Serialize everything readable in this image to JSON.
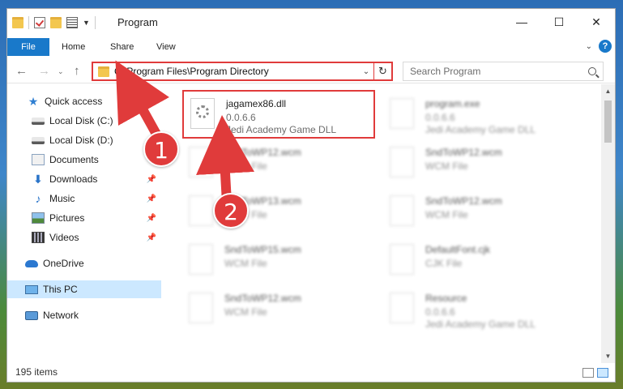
{
  "window": {
    "title": "Program",
    "controls": {
      "minimize": "—",
      "maximize": "☐",
      "close": "✕"
    }
  },
  "ribbon": {
    "tabs": [
      "File",
      "Home",
      "Share",
      "View"
    ],
    "help": "?"
  },
  "address": {
    "path": "C:\\Program Files\\Program Directory",
    "refresh_icon": "refresh-icon"
  },
  "search": {
    "placeholder": "Search Program"
  },
  "sidebar": {
    "items": [
      {
        "label": "Quick access",
        "icon": "star-icon"
      },
      {
        "label": "Local Disk (C:)",
        "icon": "disk-icon"
      },
      {
        "label": "Local Disk (D:)",
        "icon": "disk-icon"
      },
      {
        "label": "Documents",
        "icon": "documents-icon"
      },
      {
        "label": "Downloads",
        "icon": "downloads-icon"
      },
      {
        "label": "Music",
        "icon": "music-icon"
      },
      {
        "label": "Pictures",
        "icon": "pictures-icon"
      },
      {
        "label": "Videos",
        "icon": "videos-icon"
      },
      {
        "label": "OneDrive",
        "icon": "onedrive-icon"
      },
      {
        "label": "This PC",
        "icon": "pc-icon"
      },
      {
        "label": "Network",
        "icon": "network-icon"
      }
    ]
  },
  "files": [
    {
      "name": "jagamex86.dll",
      "line1": "0.0.6.6",
      "line2": "Jedi Academy Game DLL"
    },
    {
      "name": "program.exe",
      "line1": "0.0.6.6",
      "line2": "Jedi Academy Game DLL"
    },
    {
      "name": "SndToWP12.wcm",
      "line1": "WCM File",
      "line2": ""
    },
    {
      "name": "SndToWP12.wcm",
      "line1": "WCM File",
      "line2": ""
    },
    {
      "name": "SndToWP13.wcm",
      "line1": "WCM File",
      "line2": ""
    },
    {
      "name": "SndToWP12.wcm",
      "line1": "WCM File",
      "line2": ""
    },
    {
      "name": "SndToWP15.wcm",
      "line1": "WCM File",
      "line2": ""
    },
    {
      "name": "DefaultFont.cjk",
      "line1": "CJK File",
      "line2": ""
    },
    {
      "name": "SndToWP12.wcm",
      "line1": "WCM File",
      "line2": ""
    },
    {
      "name": "Resource",
      "line1": "0.0.6.6",
      "line2": "Jedi Academy Game DLL"
    }
  ],
  "status": {
    "count": "195 items"
  },
  "annotations": {
    "step1": "1",
    "step2": "2",
    "color": "#e03b3b"
  }
}
